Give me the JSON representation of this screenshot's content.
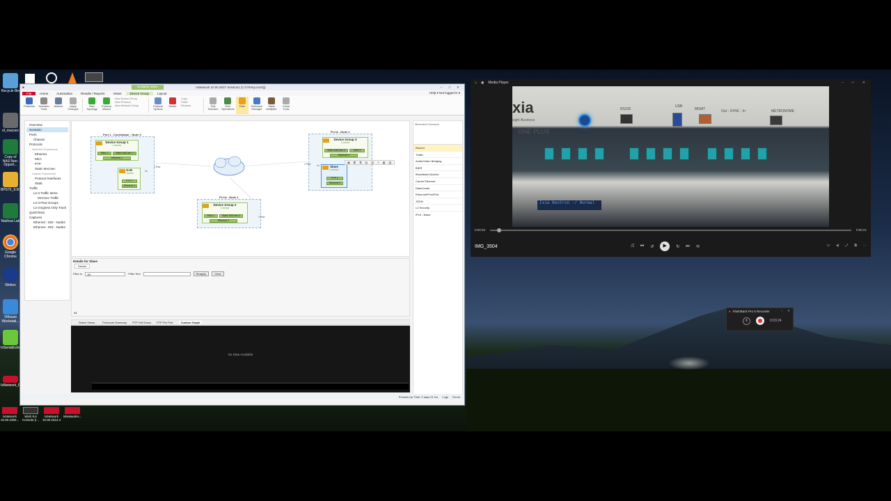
{
  "desktop": {
    "icons": [
      {
        "label": "Recycle Bin",
        "color": "#5aa0d8"
      },
      {
        "label": "of_macsec",
        "color": "#6a6a6a"
      },
      {
        "label": "Copy of NAS Non-Opport...",
        "color": "#1f7a3c"
      },
      {
        "label": "BPS75_9.00",
        "color": "#e8b030"
      },
      {
        "label": "Nashua Lab",
        "color": "#1f7a3c"
      },
      {
        "label": "Google Chrome",
        "color": "#3a8ad8"
      },
      {
        "label": "Webex",
        "color": "#1a3a8a"
      },
      {
        "label": "VMware Workstati...",
        "color": "#3a8ad8"
      },
      {
        "label": "IxSerialEcher",
        "color": "#6ac83a"
      },
      {
        "label": "IxNetwork_R...",
        "color": "#c8102e"
      }
    ],
    "taskbar": [
      {
        "label": "IxNetwork 10.00.2480..."
      },
      {
        "label": "Wish 8.6 Console (I..."
      },
      {
        "label": "IxNetwork 10.00.2312.4"
      },
      {
        "label": "IxNetworkA..."
      }
    ]
  },
  "ixnetwork": {
    "title": "IxNetwork 10.00.3037 Session1 (C:\\r\\Temp.ixncfg)",
    "context_tab": "Scalable Slave",
    "window_controls": [
      "–",
      "□",
      "✕"
    ],
    "menu": [
      "File",
      "Home",
      "Automation",
      "Results / Reports",
      "Views",
      "Device Group",
      "Layout"
    ],
    "menu_right": "Help ▾    Not logged in ▾",
    "ribbon": {
      "buttons": [
        {
          "label": "Protocols",
          "icon": "protocols-icon",
          "color": "#3a6ab8"
        },
        {
          "label": "Scenario Tools",
          "icon": "scenario-icon",
          "color": "#8a8a8a"
        },
        {
          "label": "Actions",
          "icon": "actions-icon",
          "color": "#6a7a9a"
        },
        {
          "label": "Apply Changes",
          "icon": "apply-icon",
          "color": "#aaaaaa"
        },
        {
          "label": "New Topology",
          "icon": "plus-icon",
          "color": "#3ca83c"
        },
        {
          "label": "Protocol Wizard",
          "icon": "plus-icon",
          "color": "#3ca83c"
        }
      ],
      "small_items": [
        "New Device Group",
        "New Protocol",
        "New Network Group"
      ],
      "buttons2": [
        {
          "label": "Protocol Options",
          "icon": "options-icon",
          "color": "#6a8ac8"
        },
        {
          "label": "Delete",
          "icon": "delete-icon",
          "color": "#d03030"
        }
      ],
      "small_items2": [
        "Copy",
        "Paste",
        "Rename"
      ],
      "buttons3": [
        {
          "label": "Test Scenario",
          "icon": "test-icon",
          "color": "#aaaaaa"
        },
        {
          "label": "Grid Operations",
          "icon": "grid-icon",
          "color": "#4a8a4a"
        },
        {
          "label": "Filter",
          "icon": "filter-icon",
          "color": "#e8a020"
        },
        {
          "label": "Resource Manager",
          "icon": "resource-icon",
          "color": "#4a78c8"
        },
        {
          "label": "Stack Multiplier",
          "icon": "stack-icon",
          "color": "#7a5a3a"
        },
        {
          "label": "Cloud Tools",
          "icon": "cloud-icon",
          "color": "#aaaaaa"
        }
      ]
    },
    "nav": [
      {
        "label": "Overview",
        "indent": 1
      },
      {
        "label": "Scenario",
        "indent": 1,
        "selected": true
      },
      {
        "label": "Ports",
        "indent": 1
      },
      {
        "label": "Chassis",
        "indent": 2
      },
      {
        "label": "Protocols",
        "indent": 1
      },
      {
        "label": "NextGen Framework",
        "indent": 2,
        "dim": true
      },
      {
        "label": "Ethernet",
        "indent": 2
      },
      {
        "label": "MKA",
        "indent": 2
      },
      {
        "label": "PTP",
        "indent": 2
      },
      {
        "label": "Static MACsec",
        "indent": 2
      },
      {
        "label": "Classic Framework",
        "indent": 2,
        "dim": true
      },
      {
        "label": "Protocol Interfaces",
        "indent": 2
      },
      {
        "label": "Static",
        "indent": 2
      },
      {
        "label": "Traffic",
        "indent": 1
      },
      {
        "label": "L2-3 Traffic Items",
        "indent": 2
      },
      {
        "label": "MACsec Traffic",
        "indent": 3
      },
      {
        "label": "L2-3 Flow Groups",
        "indent": 2
      },
      {
        "label": "L2-3 Egress Only Track",
        "indent": 2
      },
      {
        "label": "QuickTests",
        "indent": 1
      },
      {
        "label": "Captures",
        "indent": 1
      },
      {
        "label": "Ethernet - 002 - Node2",
        "indent": 2
      },
      {
        "label": "Ethernet - 003 - Node3",
        "indent": 2
      }
    ],
    "topology": {
      "node0": {
        "title": "Port 1 - Coordinator - Node 0",
        "port": "1 Port"
      },
      "node1": {
        "title": "PLCA - Node 1",
        "port": "1 Port"
      },
      "node2": {
        "title": "PLCA - Node 2",
        "port": "1 Port"
      },
      "dg1": {
        "title": "Device Group 1",
        "sub": "1 device",
        "pills": [
          "MKA 1",
          "Static MACsec 1",
          "Ethernet 1"
        ]
      },
      "gm": {
        "title": "G-M",
        "sub": "1 device",
        "pills": [
          "PTP 1",
          "Ethernet 4"
        ],
        "mult": "1x"
      },
      "dg2": {
        "title": "Device Group 2",
        "sub": "1 device",
        "pills": [
          "MKA 1",
          "Static MACsec 2",
          "Ethernet 2"
        ]
      },
      "dg3": {
        "title": "Device Group 3",
        "sub": "1 device",
        "pills": [
          "Static MACsec 3",
          "MKA 3",
          "Ethernet 3"
        ]
      },
      "slave": {
        "title": "Slave",
        "sub": "1 device",
        "pills": [
          "PTP 2",
          "Ethernet 5"
        ],
        "mult": "1x"
      }
    },
    "right_pane": {
      "mini_title": "Minimized Scenario",
      "items": [
        "Recent",
        "Traffic",
        "Audio/Video Bridging",
        "BIER",
        "Broadband Access",
        "Carrier Ethernet",
        "DataCenter",
        "Ethernet/IPv4/IPv6",
        "JSON",
        "L2 Security",
        "IPv4 - Basic"
      ],
      "selected": "Recent"
    },
    "details": {
      "title": "Details for Slave",
      "tab": "Device",
      "filter_in_label": "Filter In",
      "filter_in_value": "All",
      "filter_text_label": "Filter Text",
      "reapply": "Reapply",
      "clear": "Clear",
      "footer": "All"
    },
    "views_tabs": [
      "Select Views...",
      "Protocols Summary",
      "PTP Drill Down",
      "PTP Per Port",
      "Custom Graph"
    ],
    "active_view": "Custom Graph",
    "no_data": "No Data Available",
    "status": {
      "uptime": "Process Up Time: 0 days 01 hrs",
      "logs": "Logs",
      "errors": "Errors"
    }
  },
  "media_player": {
    "title": "Media Player",
    "window_controls": [
      "–",
      "□",
      "✕"
    ],
    "video": {
      "logo": "xia",
      "tagline": "sight Business",
      "product": "ONE PLUS",
      "labels": [
        "RS232",
        "USB",
        "MGMT",
        "Out - SYNC - In",
        "METRONOME"
      ],
      "lcd": "Ixia   Nextron  -/\nNormal"
    },
    "file_name": "IMG_3504",
    "time_elapsed": "0:00:03",
    "time_total": "0:00:21",
    "progress": 0.02
  },
  "recorder": {
    "title": "FlashBack Pro 5 Recorder",
    "time": "0:03:24"
  }
}
